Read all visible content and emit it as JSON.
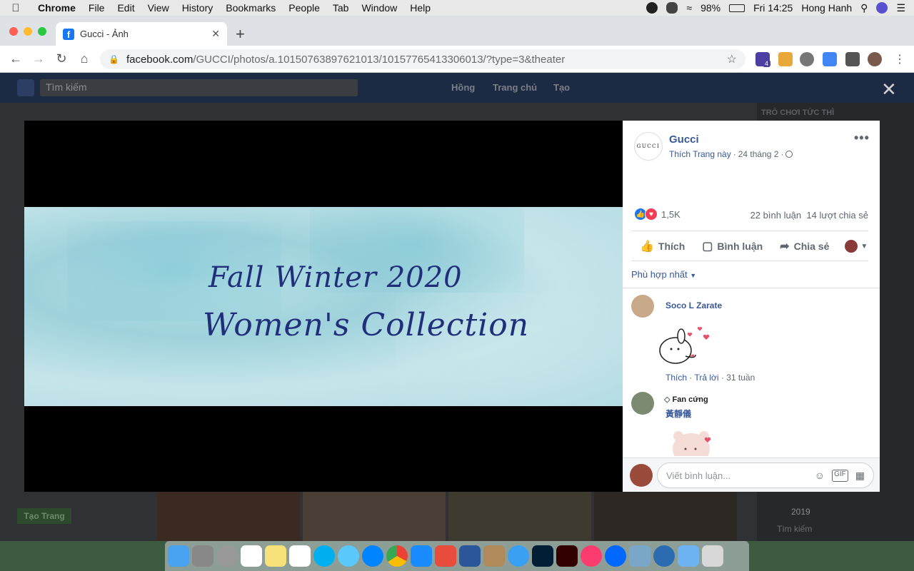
{
  "menubar": {
    "app": "Chrome",
    "items": [
      "File",
      "Edit",
      "View",
      "History",
      "Bookmarks",
      "People",
      "Tab",
      "Window",
      "Help"
    ],
    "battery": "98%",
    "clock": "Fri 14:25",
    "user": "Hong Hanh"
  },
  "tab": {
    "title": "Gucci - Ảnh",
    "new_tab_symbol": "+"
  },
  "address": {
    "domain": "facebook.com",
    "path": "/GUCCI/photos/a.10150763897621013/10157765413306013/?type=3&theater"
  },
  "extensions": {
    "badge_count": "4"
  },
  "fb": {
    "search_placeholder": "Tìm kiếm",
    "nav": [
      "Hồng",
      "Trang chủ",
      "Tạo"
    ],
    "right_heading": "TRÒ CHƠI TỨC THÌ",
    "create_page": "Tạo Trang",
    "year": "2019",
    "bottom_search": "Tìm kiếm"
  },
  "photo": {
    "line1": "Fall Winter 2020",
    "line2": "Women's Collection"
  },
  "post": {
    "author": "Gucci",
    "logo_text": "GUCCI",
    "like_page": "Thích Trang này",
    "date": "24 tháng 2",
    "reaction_count": "1,5K",
    "comments": "22 bình luận",
    "shares": "14 lượt chia sẻ",
    "actions": {
      "like": "Thích",
      "comment": "Bình luận",
      "share": "Chia sẻ"
    },
    "sort": "Phù hợp nhất"
  },
  "comments": [
    {
      "name": "Soco L Zarate",
      "like": "Thích",
      "reply": "Trả lời",
      "time": "31 tuần"
    },
    {
      "badge": "Fan cứng",
      "name": "黃靜儀"
    }
  ],
  "composer": {
    "placeholder": "Viết bình luận..."
  },
  "colors": {
    "fb_blue": "#385898",
    "like_blue": "#1877f2",
    "love_red": "#f33e58"
  }
}
